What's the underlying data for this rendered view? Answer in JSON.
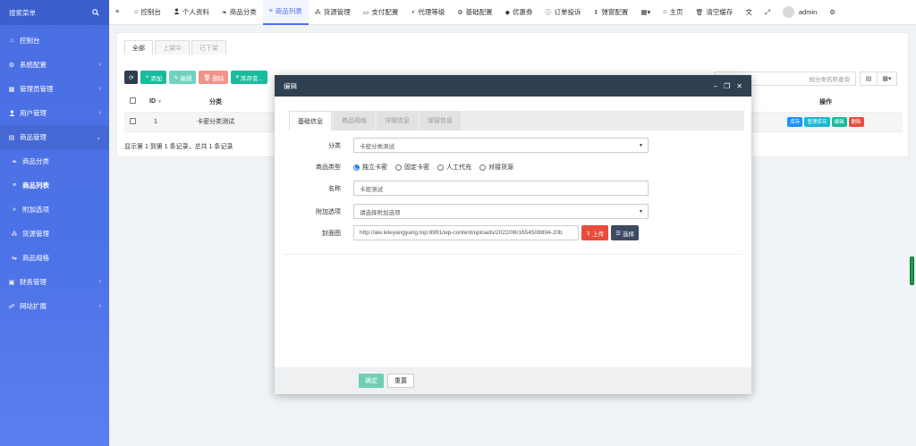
{
  "sidebar": {
    "search_label": "搜索菜单",
    "items": [
      {
        "label": "控制台",
        "icon": "⌂"
      },
      {
        "label": "系统配置",
        "icon": "⚙"
      },
      {
        "label": "管理员管理",
        "icon": "▦"
      },
      {
        "label": "用户管理",
        "icon": "👤"
      },
      {
        "label": "商品管理",
        "icon": "▤"
      },
      {
        "label": "商品分类",
        "icon": "❧"
      },
      {
        "label": "商品列表",
        "icon": "≡"
      },
      {
        "label": "附加选项",
        "icon": "»"
      },
      {
        "label": "货源管理",
        "icon": "⁂"
      },
      {
        "label": "商品规格",
        "icon": "⇋"
      },
      {
        "label": "财务管理",
        "icon": "▣"
      },
      {
        "label": "网站扩展",
        "icon": "☍"
      }
    ]
  },
  "topnav": {
    "items": [
      {
        "label": "",
        "icon": "≡"
      },
      {
        "label": "控制台",
        "icon": "⌂"
      },
      {
        "label": "个人资料",
        "icon": "👤"
      },
      {
        "label": "商品分类",
        "icon": "❧"
      },
      {
        "label": "商品列表",
        "icon": "≡"
      },
      {
        "label": "货源管理",
        "icon": "⁂"
      },
      {
        "label": "支付配置",
        "icon": "▭"
      },
      {
        "label": "代理等级",
        "icon": "⚡"
      },
      {
        "label": "基础配置",
        "icon": "⚙"
      },
      {
        "label": "优惠券",
        "icon": "◆"
      },
      {
        "label": "订单投诉",
        "icon": "ⓘ"
      },
      {
        "label": "弹窗配置",
        "icon": "⇕"
      }
    ],
    "more_icon": "▦▾",
    "home_label": "主页",
    "clear_cache_label": "清空缓存",
    "user_name": "admin"
  },
  "main": {
    "tabs": [
      "全部",
      "上架中",
      "已下架"
    ],
    "toolbar": {
      "refresh_icon": "⟳",
      "add_label": "添加",
      "edit_label": "编辑",
      "delete_label": "删除",
      "stock_label": "库存变..."
    },
    "search_placeholder": "规分类名称查询",
    "table": {
      "headers": [
        "ID",
        "分类",
        "操作"
      ],
      "rows": [
        {
          "id": "1",
          "category": "卡密分类测试"
        }
      ],
      "row_actions": [
        "库存",
        "管理库存",
        "编辑",
        "删除"
      ]
    },
    "summary": "显示第 1 到第 1 条记录，总共 1 条记录"
  },
  "modal": {
    "title": "编辑",
    "tabs": [
      "基础信息",
      "商品规格",
      "详细信息",
      "弹窗信息"
    ],
    "fields": {
      "category_label": "分类",
      "category_value": "卡密分类测试",
      "type_label": "商品类型",
      "type_options": [
        "独立卡密",
        "固定卡密",
        "人工代充",
        "对接货源"
      ],
      "name_label": "名称",
      "name_value": "卡密测试",
      "addon_label": "附加选项",
      "addon_placeholder": "请选择附加选项",
      "cover_label": "封面图",
      "cover_value": "http://ale.leleyangyang.top:8991/wp-content/uploads/2022/06/1654508894-20b",
      "upload_label": "上传",
      "choose_label": "选择"
    },
    "ok_label": "确定",
    "reset_label": "重置"
  },
  "colors": {
    "sidebar": "#4d73e8",
    "accent": "#4e6ef2",
    "modal_header": "#2f4050",
    "success": "#18bc9c",
    "danger": "#e74c3c"
  }
}
